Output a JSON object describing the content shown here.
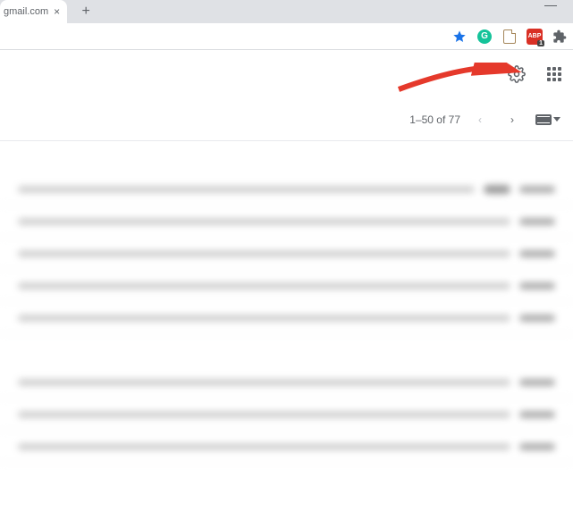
{
  "browser": {
    "tab_title": "gmail.com",
    "close_glyph": "×",
    "new_tab_glyph": "+",
    "extensions": {
      "star": "star-icon",
      "grammarly": "G",
      "doc": "doc-icon",
      "abp": "ABP",
      "abp_badge": "1",
      "puzzle": "extensions-icon"
    }
  },
  "gmail_header": {
    "settings": "Settings",
    "apps": "Google apps"
  },
  "toolbar": {
    "pagination": "1–50 of 77",
    "prev": "‹",
    "next": "›",
    "input_tool": "Input tools"
  },
  "annotation": {
    "type": "arrow",
    "color": "#e5392b",
    "target": "settings-button"
  },
  "messages": [
    {
      "has_label": true
    },
    {
      "has_label": false
    },
    {
      "has_label": false
    },
    {
      "has_label": false
    },
    {
      "has_label": false
    },
    {
      "has_label": false
    },
    {
      "has_label": false
    },
    {
      "has_label": false
    }
  ]
}
